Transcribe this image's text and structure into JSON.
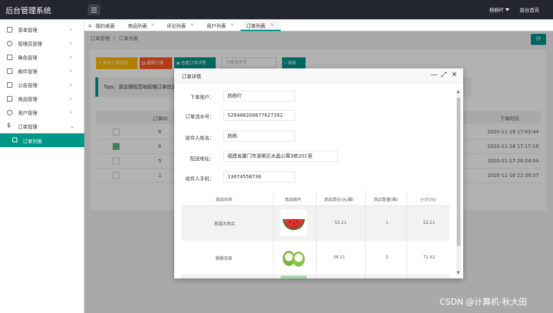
{
  "app": {
    "title": "后台管理系统",
    "user": "杨杨吖",
    "home_link": "前台首页"
  },
  "sidebar": {
    "items": [
      {
        "label": "菜单管理"
      },
      {
        "label": "管理员管理"
      },
      {
        "label": "角色管理"
      },
      {
        "label": "邮件管理"
      },
      {
        "label": "公告管理"
      },
      {
        "label": "商品管理"
      },
      {
        "label": "用户管理"
      },
      {
        "label": "订单管理"
      }
    ],
    "sub_item": "订单列表"
  },
  "tabs": [
    {
      "label": "我的桌面"
    },
    {
      "label": "商品列表"
    },
    {
      "label": "评论列表"
    },
    {
      "label": "用户列表"
    },
    {
      "label": "订单列表"
    }
  ],
  "breadcrumb": {
    "parent": "订单管理",
    "sep": "/",
    "current": "订单列表"
  },
  "toolbar": {
    "edit_status": "修改订单状态",
    "delete": "删除订单",
    "view": "查看订单详情",
    "search_placeholder": "订单流水号",
    "search": "搜索"
  },
  "tips": "Tips：请合理规范地管理订单信息哦",
  "table": {
    "headers": {
      "id": "订单ID",
      "time": "下单时间"
    },
    "rows": [
      {
        "id": "8",
        "time": "2020-11-19 17:03:44",
        "checked": false
      },
      {
        "id": "6",
        "time": "2020-11-18 17:17:18",
        "checked": true
      },
      {
        "id": "5",
        "time": "2020-11-17 20:24:04",
        "checked": false
      },
      {
        "id": "1",
        "time": "2020-11-16 22:39:37",
        "checked": false
      }
    ]
  },
  "modal": {
    "title": "订单详情",
    "fields": [
      {
        "label": "下单用户：",
        "value": "杨杨吖"
      },
      {
        "label": "订单流水号：",
        "value": "526488209677627392"
      },
      {
        "label": "收件人姓名：",
        "value": "杨杨"
      },
      {
        "label": "配送地址：",
        "value": "福建省厦门市湖里区水晶公寓3栋201室"
      },
      {
        "label": "收件人手机：",
        "value": "13674558736"
      }
    ],
    "items_table": {
      "headers": [
        "商品名称",
        "商品图片",
        "商品单价(元/箱)",
        "购买数量(箱)",
        "小计(元)"
      ],
      "rows": [
        {
          "name": "新疆大西瓜",
          "image": "watermelon-image",
          "price": "52.21",
          "qty": "1",
          "subtotal": "52.21"
        },
        {
          "name": "脆脆花菜",
          "image": "cauliflower-image",
          "price": "36.21",
          "qty": "2",
          "subtotal": "72.42"
        }
      ]
    }
  },
  "watermark": "CSDN @计算机-秋大田",
  "colors": {
    "accent": "#009688",
    "topbar": "#23262e",
    "warn": "#ffb800",
    "danger": "#ff5722"
  }
}
